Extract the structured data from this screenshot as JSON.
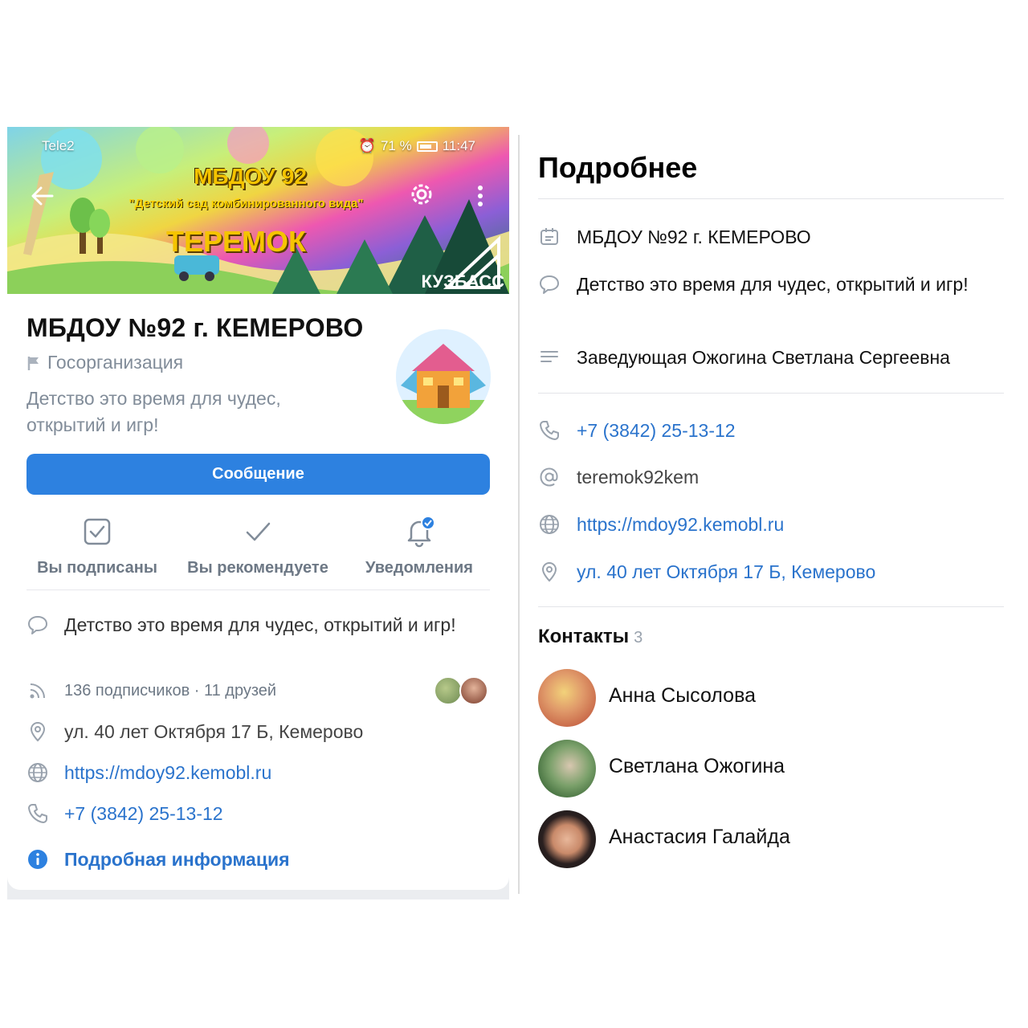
{
  "left": {
    "status_bar": {
      "carrier": "Tele2",
      "battery": "71 %",
      "time": "11:47"
    },
    "cover": {
      "line1": "МБДОУ 92",
      "line2": "\"Детский сад комбинированного вида\"",
      "line3": "ТЕРЕМОК",
      "brand": "КУЗБАСС"
    },
    "org_name": "МБДОУ №92 г. КЕМЕРОВО",
    "org_type": "Госорганизация",
    "status": "Детство это время для чудес, открытий и игр!",
    "message_button": "Сообщение",
    "actions": [
      {
        "label": "Вы подписаны",
        "icon": "checkbox-icon"
      },
      {
        "label": "Вы рекомендуете",
        "icon": "checkmark-icon"
      },
      {
        "label": "Уведомления",
        "icon": "bell-icon"
      }
    ],
    "info": {
      "status": "Детство это время для чудес, открытий и игр!",
      "followers": "136 подписчиков · 11 друзей",
      "address": "ул. 40 лет Октября 17 Б, Кемерово",
      "site": "https://mdoy92.kemobl.ru",
      "phone": "+7 (3842) 25-13-12",
      "more": "Подробная информация"
    },
    "colors": {
      "accent": "#2d81e0",
      "link": "#2a73cc",
      "secondary": "#818c99"
    }
  },
  "right": {
    "title": "Подробнее",
    "rows": {
      "name": "МБДОУ №92 г. КЕМЕРОВО",
      "status": "Детство это время для чудес, открытий и игр!",
      "description": "Заведующая Ожогина Светлана Сергеевна",
      "phone": "+7 (3842) 25-13-12",
      "email": "teremok92kem",
      "site": "https://mdoy92.kemobl.ru",
      "address": "ул. 40 лет Октября 17 Б, Кемерово"
    },
    "contacts_title": "Контакты",
    "contacts_count": "3",
    "contacts": [
      {
        "name": "Анна Сысолова"
      },
      {
        "name": "Светлана Ожогина"
      },
      {
        "name": "Анастасия Галайда"
      }
    ]
  }
}
